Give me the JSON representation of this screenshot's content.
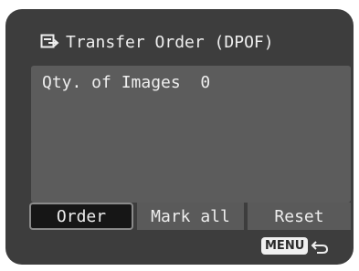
{
  "header": {
    "title": "Transfer Order (DPOF)",
    "icon": "transfer-order-icon"
  },
  "content": {
    "qty_label": "Qty. of Images",
    "qty_value": "0"
  },
  "buttons": {
    "order": "Order",
    "mark_all": "Mark all",
    "reset": "Reset",
    "selected": "Order"
  },
  "footer": {
    "menu_label": "MENU",
    "back_icon": "return-arrow-icon"
  },
  "colors": {
    "background": "#3d3d3d",
    "panel": "#5c5c5c",
    "selected_button": "#161616",
    "text": "#eeeeee"
  }
}
